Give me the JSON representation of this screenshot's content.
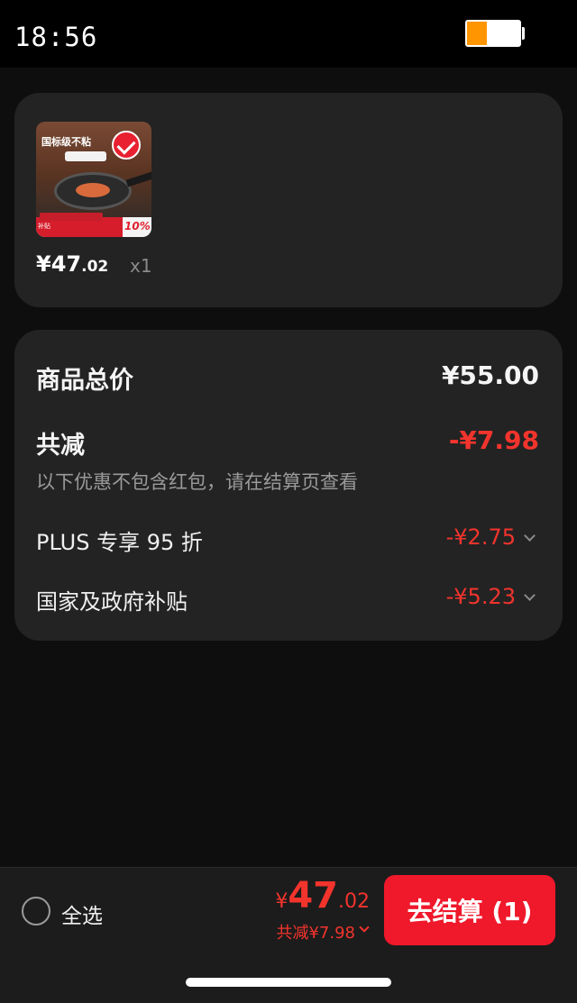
{
  "status_bar": {
    "time": "18:56",
    "battery_level": 0.38
  },
  "product": {
    "thumb_banner": "国标级不粘",
    "thumb_badge_label": "补贴",
    "thumb_discount": "10%",
    "price_yen": "¥",
    "price_int": "47",
    "price_dec": ".02",
    "quantity": "x1"
  },
  "summary": {
    "total_label": "商品总价",
    "total_value": "¥55.00",
    "reduce_label": "共减",
    "reduce_value": "-¥7.98",
    "note": "以下优惠不包含红包，请在结算页查看",
    "discounts": [
      {
        "label": "PLUS 专享 95 折",
        "value": "-¥2.75"
      },
      {
        "label": "国家及政府补贴",
        "value": "-¥5.23"
      }
    ]
  },
  "bottom_bar": {
    "select_all_label": "全选",
    "total_yen": "¥",
    "total_int": "47",
    "total_dec": ".02",
    "total_discount": "共减¥7.98",
    "checkout_label": "去结算 (1)"
  },
  "colors": {
    "accent": "#f0182b",
    "discount": "#f2342d",
    "card": "#232323",
    "background": "#0e0e0e"
  }
}
